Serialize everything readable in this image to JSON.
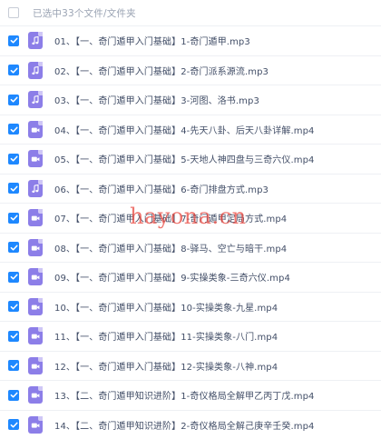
{
  "header": {
    "selection_text": "已选中33个文件/文件夹"
  },
  "files": [
    {
      "name": "01、【一、奇门遁甲入门基础】1-奇门遁甲.mp3",
      "type": "audio"
    },
    {
      "name": "02、【一、奇门遁甲入门基础】2-奇门派系源流.mp3",
      "type": "audio"
    },
    {
      "name": "03、【一、奇门遁甲入门基础】3-河图、洛书.mp3",
      "type": "audio"
    },
    {
      "name": "04、【一、奇门遁甲入门基础】4-先天八卦、后天八卦详解.mp4",
      "type": "video"
    },
    {
      "name": "05、【一、奇门遁甲入门基础】5-天地人神四盘与三奇六仪.mp4",
      "type": "video"
    },
    {
      "name": "06、【一、奇门遁甲入门基础】6-奇门排盘方式.mp3",
      "type": "audio"
    },
    {
      "name": "07、【一、奇门遁甲入门基础】7-奇门遁甲定局方式.mp4",
      "type": "video"
    },
    {
      "name": "08、【一、奇门遁甲入门基础】8-驿马、空亡与暗干.mp4",
      "type": "video"
    },
    {
      "name": "09、【一、奇门遁甲入门基础】9-实操类象-三奇六仪.mp4",
      "type": "video"
    },
    {
      "name": "10、【一、奇门遁甲入门基础】10-实操类象-九星.mp4",
      "type": "video"
    },
    {
      "name": "11、【一、奇门遁甲入门基础】11-实操类象-八门.mp4",
      "type": "video"
    },
    {
      "name": "12、【一、奇门遁甲入门基础】12-实操类象-八神.mp4",
      "type": "video"
    },
    {
      "name": "13、【二、奇门遁甲知识进阶】1-奇仪格局全解甲乙丙丁戊.mp4",
      "type": "video"
    },
    {
      "name": "14、【二、奇门遁甲知识进阶】2-奇仪格局全解己庚辛壬癸.mp4",
      "type": "video"
    }
  ],
  "watermark": "hayona.cn",
  "colors": {
    "checkbox": "#1e88ff",
    "file_icon": "#8c7ee8",
    "watermark": "#e8423a"
  }
}
